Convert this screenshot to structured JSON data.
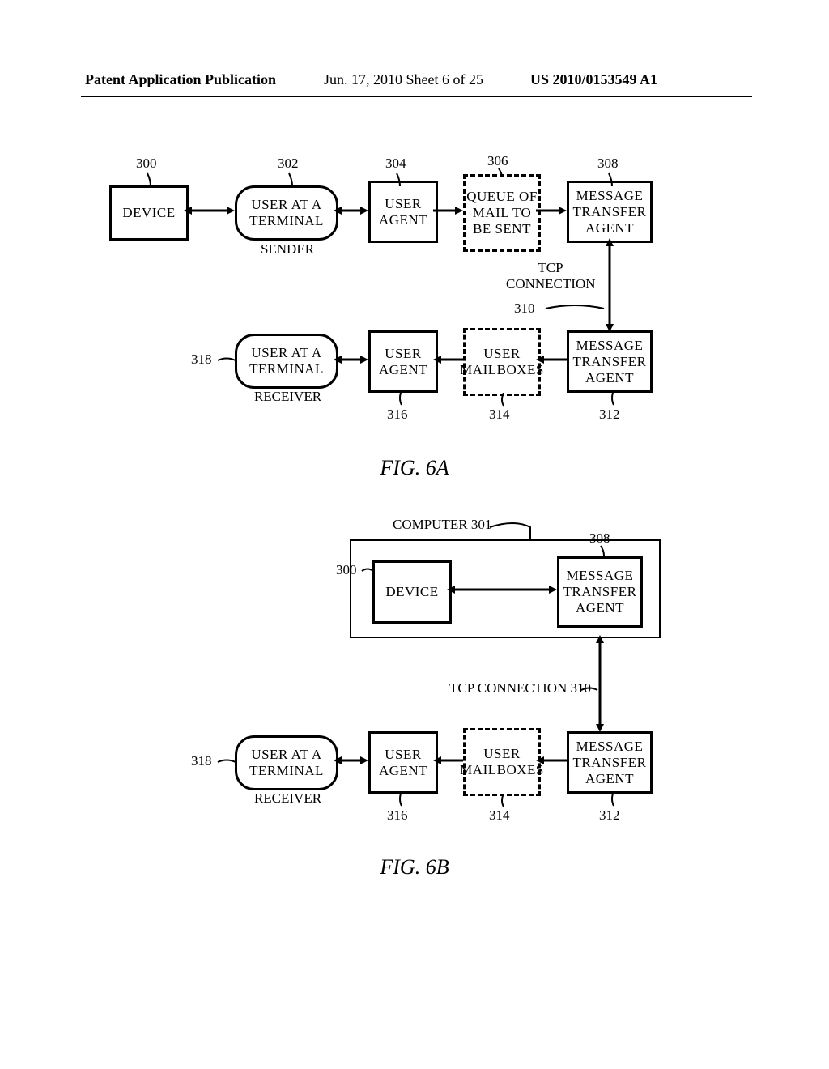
{
  "header": {
    "left": "Patent Application Publication",
    "mid": "Jun. 17, 2010  Sheet 6 of 25",
    "right": "US 2010/0153549 A1"
  },
  "figA": {
    "title": "FIG. 6A",
    "device": "DEVICE",
    "sender_terminal": "USER AT A\nTERMINAL",
    "sender_label": "SENDER",
    "user_agent_top": "USER\nAGENT",
    "queue": "QUEUE OF\nMAIL TO\nBE SENT",
    "mta_top": "MESSAGE\nTRANSFER\nAGENT",
    "tcp": "TCP\nCONNECTION",
    "receiver_terminal": "USER AT A\nTERMINAL",
    "receiver_label": "RECEIVER",
    "user_agent_bot": "USER\nAGENT",
    "mailboxes": "USER\nMAILBOXES",
    "mta_bot": "MESSAGE\nTRANSFER\nAGENT",
    "ref": {
      "n300": "300",
      "n302": "302",
      "n304": "304",
      "n306": "306",
      "n308": "308",
      "n310": "310",
      "n312": "312",
      "n314": "314",
      "n316": "316",
      "n318": "318"
    }
  },
  "figB": {
    "title": "FIG. 6B",
    "computer_label": "COMPUTER 301",
    "device": "DEVICE",
    "mta_top": "MESSAGE\nTRANSFER\nAGENT",
    "tcp": "TCP CONNECTION 310",
    "receiver_terminal": "USER AT A\nTERMINAL",
    "receiver_label": "RECEIVER",
    "user_agent": "USER\nAGENT",
    "mailboxes": "USER\nMAILBOXES",
    "mta_bot": "MESSAGE\nTRANSFER\nAGENT",
    "ref": {
      "n300": "300",
      "n308": "308",
      "n312": "312",
      "n314": "314",
      "n316": "316",
      "n318": "318"
    }
  }
}
